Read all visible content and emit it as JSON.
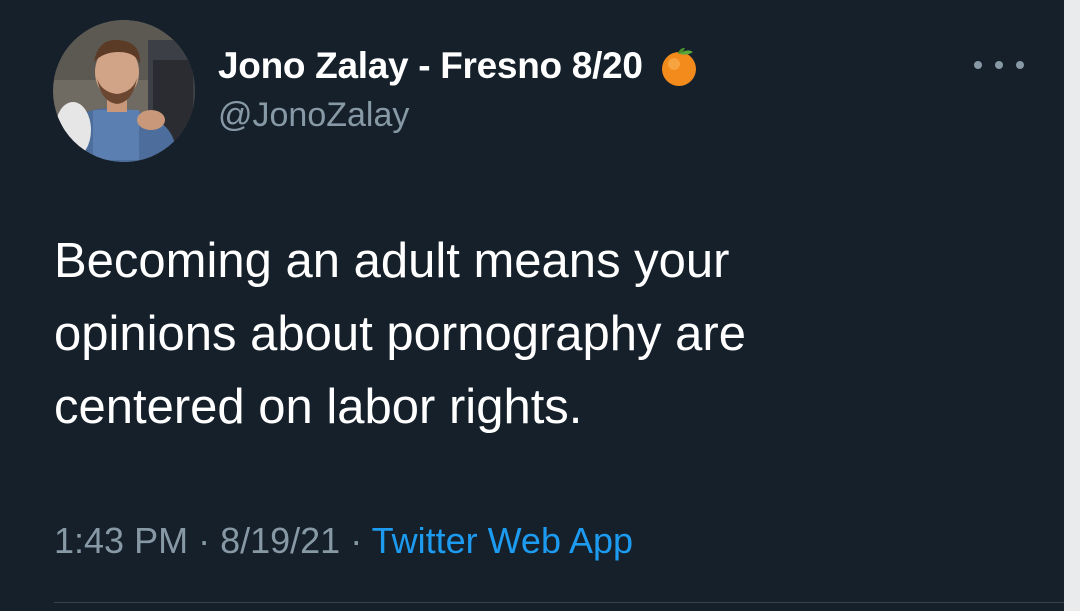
{
  "tweet": {
    "author": {
      "display_name": "Jono Zalay - Fresno 8/20",
      "handle": "@JonoZalay",
      "name_emoji": "orange-emoji-icon"
    },
    "text_lines": [
      "Becoming an adult means your",
      "opinions about pornography are",
      "centered on labor rights."
    ],
    "meta": {
      "time": "1:43 PM",
      "date": "8/19/21",
      "separator": "·",
      "source": "Twitter Web App"
    },
    "more_icon": "more-horizontal-icon"
  },
  "colors": {
    "background": "#15202b",
    "primary_text": "#ffffff",
    "secondary_text": "#8899a6",
    "link": "#1d9bf0",
    "divider": "#38444d"
  }
}
